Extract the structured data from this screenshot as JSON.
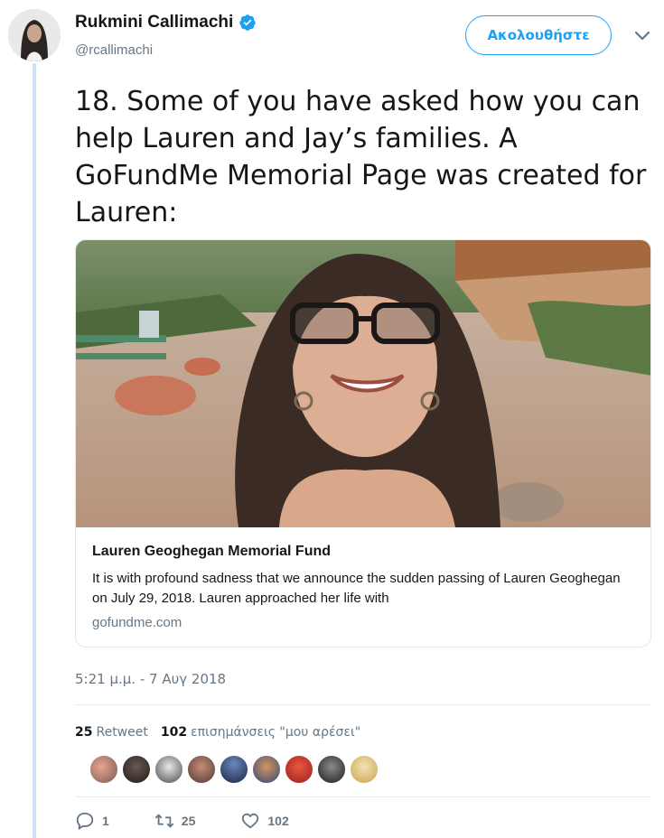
{
  "author": {
    "display_name": "Rukmini Callimachi",
    "handle": "@rcallimachi",
    "verified": true
  },
  "follow_button": {
    "label": "Ακολουθήστε"
  },
  "tweet": {
    "text": "18. Some of you have asked how you can help Lauren and Jay’s families. A GoFundMe Memorial Page was created for Lauren:",
    "timestamp": "5:21 μ.μ. - 7 Αυγ 2018"
  },
  "card": {
    "title": "Lauren Geoghegan Memorial Fund",
    "description": "It is with profound sadness that we announce the sudden passing of Lauren Geoghegan on July 29, 2018. Lauren approached her life with",
    "domain": "gofundme.com"
  },
  "stats": {
    "retweets_count": "25",
    "retweets_label": "Retweet",
    "likes_count": "102",
    "likes_label": "επισημάνσεις \"μου αρέσει\""
  },
  "actions": {
    "reply_count": "1",
    "retweet_count": "25",
    "like_count": "102"
  },
  "colors": {
    "accent": "#1da1f2",
    "verified": "#1da1f2",
    "thread_line": "#cfe3f5",
    "muted_text": "#657786"
  },
  "icons": [
    "verified-badge-icon",
    "chevron-down-icon",
    "reply-icon",
    "retweet-icon",
    "heart-icon"
  ]
}
